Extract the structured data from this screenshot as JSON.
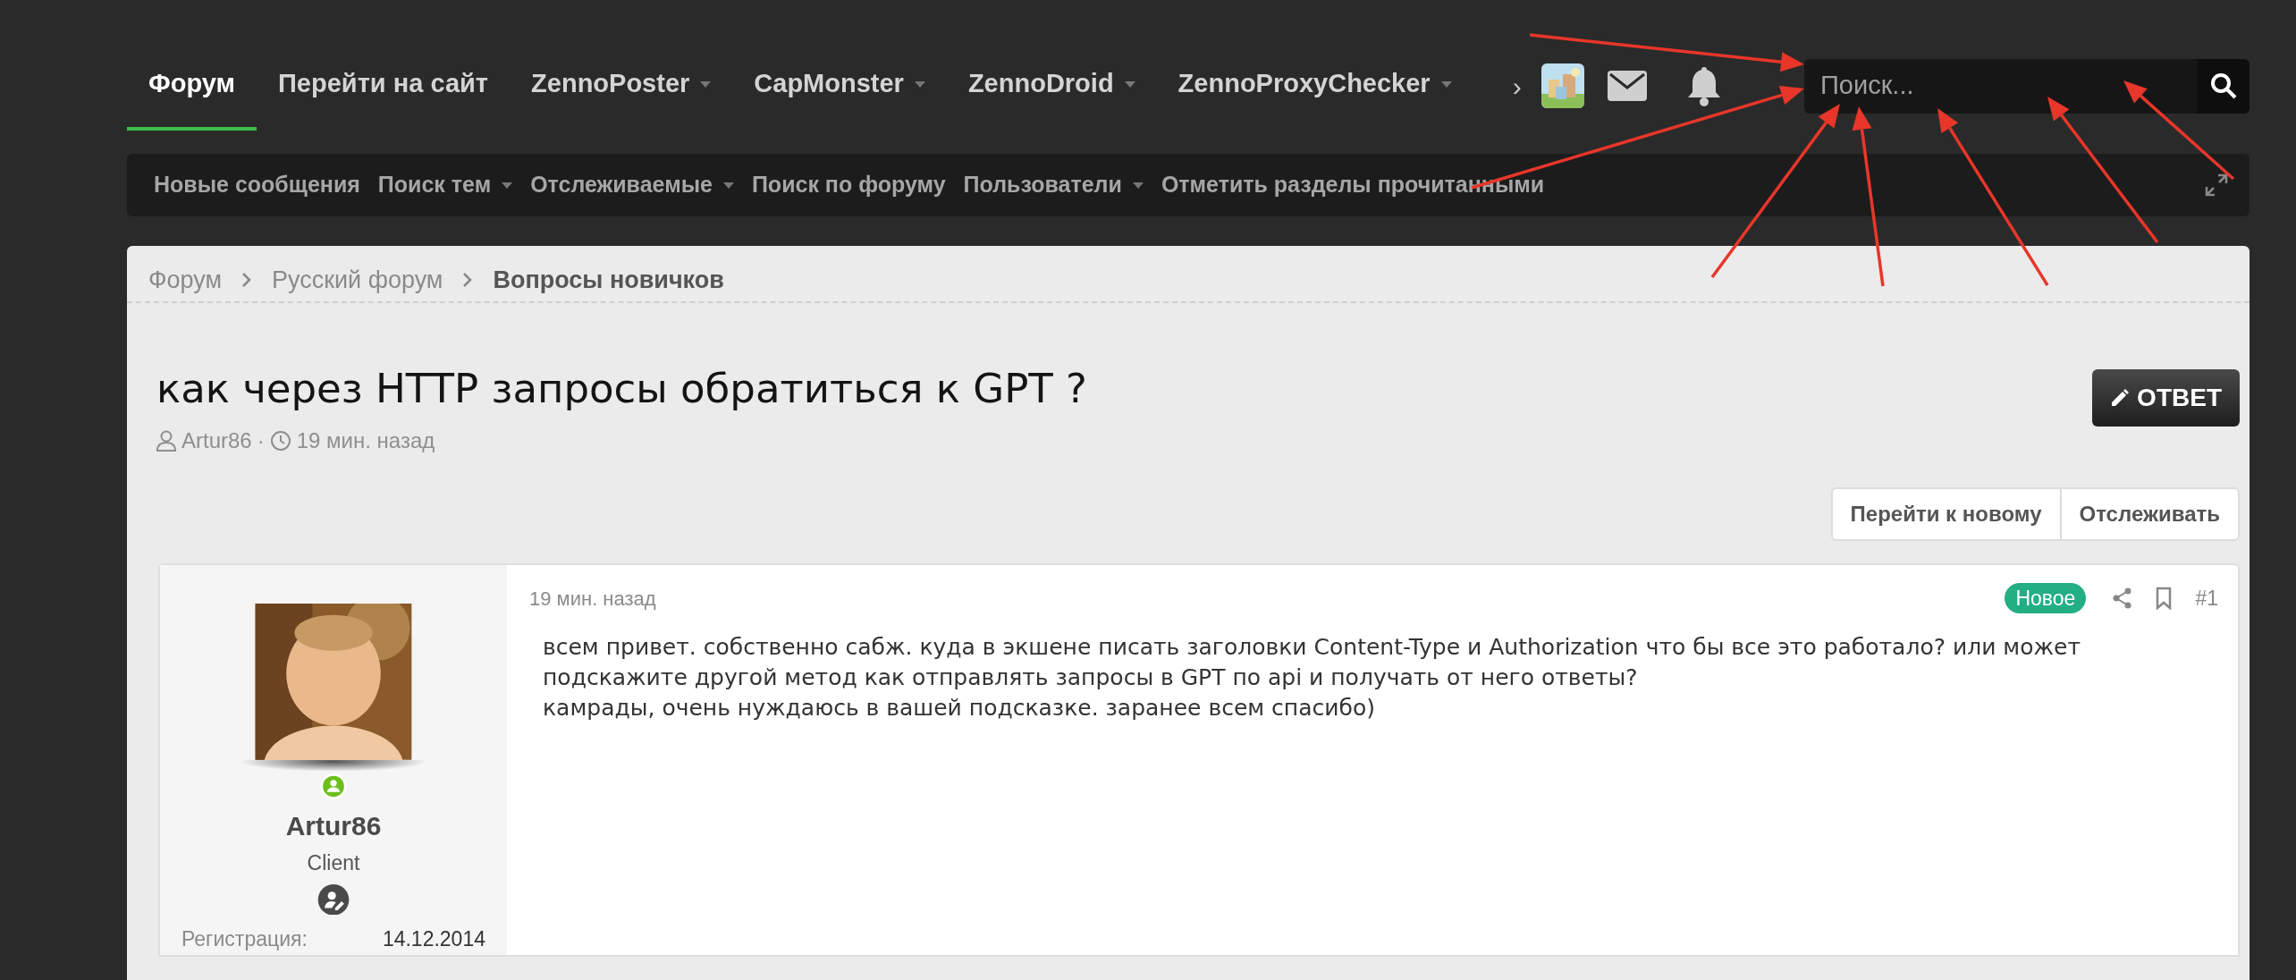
{
  "nav": {
    "items": [
      {
        "label": "Форум",
        "selected": true,
        "has_menu": false
      },
      {
        "label": "Перейти на сайт",
        "selected": false,
        "has_menu": false
      },
      {
        "label": "ZennoPoster",
        "selected": false,
        "has_menu": true
      },
      {
        "label": "CapMonster",
        "selected": false,
        "has_menu": true
      },
      {
        "label": "ZennoDroid",
        "selected": false,
        "has_menu": true
      },
      {
        "label": "ZennoProxyChecker",
        "selected": false,
        "has_menu": true
      }
    ],
    "more": "›"
  },
  "search": {
    "placeholder": "Поиск..."
  },
  "subnav": {
    "items": [
      {
        "label": "Новые сообщения",
        "has_menu": false
      },
      {
        "label": "Поиск тем",
        "has_menu": true
      },
      {
        "label": "Отслеживаемые",
        "has_menu": true
      },
      {
        "label": "Поиск по форуму",
        "has_menu": false
      },
      {
        "label": "Пользователи",
        "has_menu": true
      },
      {
        "label": "Отметить разделы прочитанными",
        "has_menu": false
      }
    ]
  },
  "breadcrumbs": [
    {
      "label": "Форум",
      "current": false
    },
    {
      "label": "Русский форум",
      "current": false
    },
    {
      "label": "Вопросы новичков",
      "current": true
    }
  ],
  "thread": {
    "title": "как через HTTP запросы обратиться к GPT ?",
    "author": "Artur86",
    "separator": "·",
    "time": "19 мин. назад"
  },
  "reply_button": "ОТВЕТ",
  "actions": [
    "Перейти к новому",
    "Отслеживать"
  ],
  "post": {
    "user": {
      "name": "Artur86",
      "title": "Client",
      "online": true,
      "stats": [
        {
          "label": "Регистрация:",
          "value": "14.12.2014"
        }
      ]
    },
    "time": "19 мин. назад",
    "badge": "Новое",
    "number": "#1",
    "lines": [
      "всем привет. собственно сабж. куда в экшене писать заголовки Content-Type и Authorization что бы все это работало? или может",
      "подскажите другой метод как отправлять запросы в GPT по api и получать от него ответы?",
      "камрады, очень нуждаюсь в вашей подсказке. заранее всем спасибо)"
    ]
  }
}
